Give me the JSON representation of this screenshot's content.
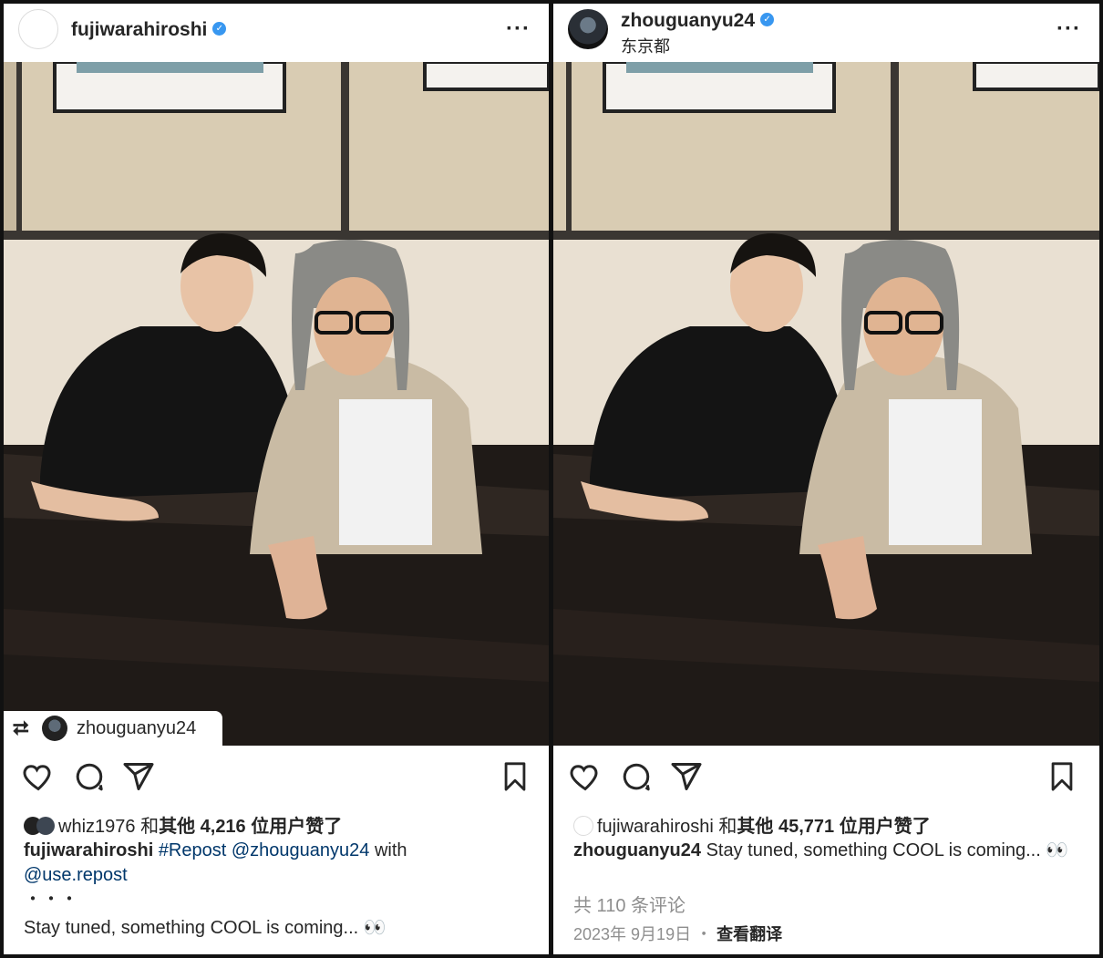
{
  "left_post": {
    "username": "fujiwarahiroshi",
    "more_label": "···",
    "repost_tag": {
      "icon": "⮂",
      "username": "zhouguanyu24"
    },
    "likes": {
      "first_user": "whiz1976",
      "connector": "和",
      "text": "其他 4,216 位用户赞了"
    },
    "caption": {
      "author": "fujiwarahiroshi",
      "hashtag": "#Repost",
      "mention": "@zhouguanyu24",
      "with": "with",
      "mention2": "@use.repost",
      "dots": "・・・",
      "body": "Stay tuned, something COOL is coming... 👀"
    }
  },
  "right_post": {
    "username": "zhouguanyu24",
    "location": "东京都",
    "more_label": "···",
    "likes": {
      "first_user": "fujiwarahiroshi",
      "connector": "和",
      "text": "其他 45,771 位用户赞了"
    },
    "caption": {
      "author": "zhouguanyu24",
      "body": "Stay tuned, something COOL is coming... 👀"
    },
    "comments_label": "共 110 条评论",
    "date": "2023年 9月19日",
    "sep": "・",
    "translate": "查看翻译"
  },
  "icons": [
    "heart-icon",
    "comment-icon",
    "share-icon",
    "bookmark-icon",
    "verified-icon",
    "repost-icon",
    "more-icon"
  ],
  "colors": {
    "verified": "#3897f0",
    "link": "#00376b",
    "muted": "#8e8e8e",
    "text": "#262626"
  }
}
